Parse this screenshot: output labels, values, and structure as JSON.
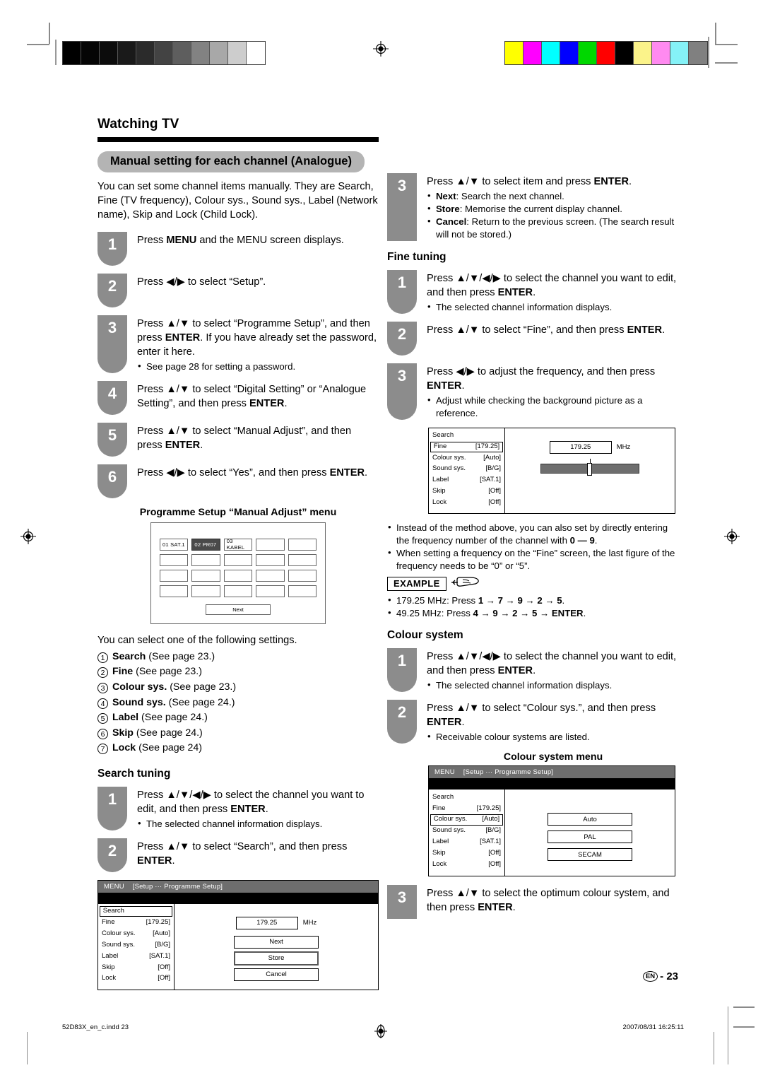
{
  "page": {
    "title": "Watching TV",
    "section": "Manual setting for each channel (Analogue)",
    "intro": "You can set some channel items manually. They are Search, Fine (TV frequency), Colour sys., Sound sys., Label (Network name), Skip and Lock (Child Lock).",
    "folio_lang": "EN",
    "folio_number": "23",
    "footer_file": "52D83X_en_c.indd  23",
    "footer_timestamp": "2007/08/31   16:25:11"
  },
  "main_steps": [
    {
      "n": "1",
      "text": "Press MENU and the MENU screen displays.",
      "bullets": []
    },
    {
      "n": "2",
      "text": "Press ◀/▶ to select “Setup”.",
      "bullets": []
    },
    {
      "n": "3",
      "text": "Press ▲/▼ to select “Programme Setup”, and then press ENTER. If you have already set the password, enter it here.",
      "bullets": [
        "See page 28 for setting a password."
      ]
    },
    {
      "n": "4",
      "text": "Press ▲/▼ to select “Digital Setting” or “Analogue Setting”, and then press ENTER.",
      "bullets": []
    },
    {
      "n": "5",
      "text": "Press ▲/▼ to select “Manual Adjust”, and then press ENTER.",
      "bullets": []
    },
    {
      "n": "6",
      "text": "Press ◀/▶ to select “Yes”, and then press ENTER.",
      "bullets": []
    }
  ],
  "manual_adjust": {
    "caption": "Programme Setup “Manual Adjust” menu",
    "cells": [
      "01 SAT.1",
      "02  PR07",
      "03  KABEL",
      "",
      "",
      "",
      "",
      "",
      "",
      "",
      "",
      "",
      "",
      "",
      "",
      "",
      "",
      "",
      "",
      ""
    ],
    "selected_index": 1,
    "next_label": "Next"
  },
  "settings_list": {
    "lead": "You can select one of the following settings.",
    "items": [
      {
        "num": "1",
        "name": "Search",
        "ref": "(See page 23.)"
      },
      {
        "num": "2",
        "name": "Fine",
        "ref": "(See page 23.)"
      },
      {
        "num": "3",
        "name": "Colour sys.",
        "ref": "(See page 23.)"
      },
      {
        "num": "4",
        "name": "Sound sys.",
        "ref": "(See page 24.)"
      },
      {
        "num": "5",
        "name": "Label",
        "ref": "(See page 24.)"
      },
      {
        "num": "6",
        "name": "Skip",
        "ref": "(See page 24.)"
      },
      {
        "num": "7",
        "name": "Lock",
        "ref": "(See page 24)"
      }
    ]
  },
  "search_tuning": {
    "heading": "Search tuning",
    "steps": [
      {
        "n": "1",
        "text": "Press ▲/▼/◀/▶ to select the channel you want to edit, and then press ENTER.",
        "bullets": [
          "The selected channel information displays."
        ]
      },
      {
        "n": "2",
        "text": "Press ▲/▼ to select “Search”, and then press ENTER.",
        "bullets": []
      },
      {
        "n": "3",
        "text": "Press ▲/▼ to select item and press ENTER.",
        "bullets": [
          "Next: Search the next channel.",
          "Store: Memorise the current display channel.",
          "Cancel: Return to the previous screen. (The search result will not be stored.)"
        ]
      }
    ]
  },
  "fine_tuning": {
    "heading": "Fine tuning",
    "steps": [
      {
        "n": "1",
        "text": "Press ▲/▼/◀/▶ to select the channel you want to edit, and then press ENTER.",
        "bullets": [
          "The selected channel information displays."
        ]
      },
      {
        "n": "2",
        "text": "Press ▲/▼ to select “Fine”, and then press ENTER.",
        "bullets": []
      },
      {
        "n": "3",
        "text": "Press ◀/▶ to adjust the frequency, and then press ENTER.",
        "bullets": [
          "Adjust while checking the background picture as a reference."
        ]
      }
    ],
    "notes": [
      "Instead of the method above, you can also set by directly entering the frequency number of the channel with 0 — 9.",
      "When setting a frequency on the “Fine” screen, the last figure of the frequency needs to be “0” or “5”."
    ],
    "example_tag": "EXAMPLE",
    "examples": [
      "179.25 MHz: Press 1 → 7 → 9 → 2 → 5.",
      "49.25 MHz: Press 4 → 9 → 2 → 5 → ENTER."
    ]
  },
  "colour_system": {
    "heading": "Colour system",
    "menu_caption": "Colour system menu",
    "steps": [
      {
        "n": "1",
        "text": "Press ▲/▼/◀/▶ to select the channel you want to edit, and then press ENTER.",
        "bullets": [
          "The selected channel information displays."
        ]
      },
      {
        "n": "2",
        "text": "Press ▲/▼ to select “Colour sys.”, and then press ENTER.",
        "bullets": [
          "Receivable colour systems are listed."
        ]
      },
      {
        "n": "3",
        "text": "Press ▲/▼ to select the optimum colour system, and then press ENTER.",
        "bullets": []
      }
    ],
    "options": [
      "Auto",
      "PAL",
      "SECAM"
    ]
  },
  "osd": {
    "menu_bar_title": "MENU",
    "menu_bar_path": "[Setup ··· Programme Setup]",
    "rows": [
      {
        "label": "Search",
        "value": ""
      },
      {
        "label": "Fine",
        "value": "[179.25]"
      },
      {
        "label": "Colour sys.",
        "value": "[Auto]"
      },
      {
        "label": "Sound sys.",
        "value": "[B/G]"
      },
      {
        "label": "Label",
        "value": "[SAT.1]"
      },
      {
        "label": "Skip",
        "value": "[Off]"
      },
      {
        "label": "Lock",
        "value": "[Off]"
      }
    ],
    "frequency_value": "179.25",
    "frequency_unit": "MHz",
    "buttons": [
      "Next",
      "Store",
      "Cancel"
    ],
    "selected_button": "Store",
    "search_selected_row": 0,
    "fine_selected_row": 1,
    "colour_selected_row": 2
  },
  "print_marks": {
    "gray_wedge": [
      "#000000",
      "#050505",
      "#0c0c0c",
      "#1a1a1a",
      "#2b2b2b",
      "#434343",
      "#5e5e5e",
      "#828282",
      "#a8a8a8",
      "#cdcdcd",
      "#ffffff"
    ],
    "color_wedge": [
      "#ffff00",
      "#ff00ff",
      "#00ffff",
      "#0000ff",
      "#00d700",
      "#ff0000",
      "#000000",
      "#fbf38a",
      "#ff8af0",
      "#85f2f7",
      "#808080"
    ]
  }
}
